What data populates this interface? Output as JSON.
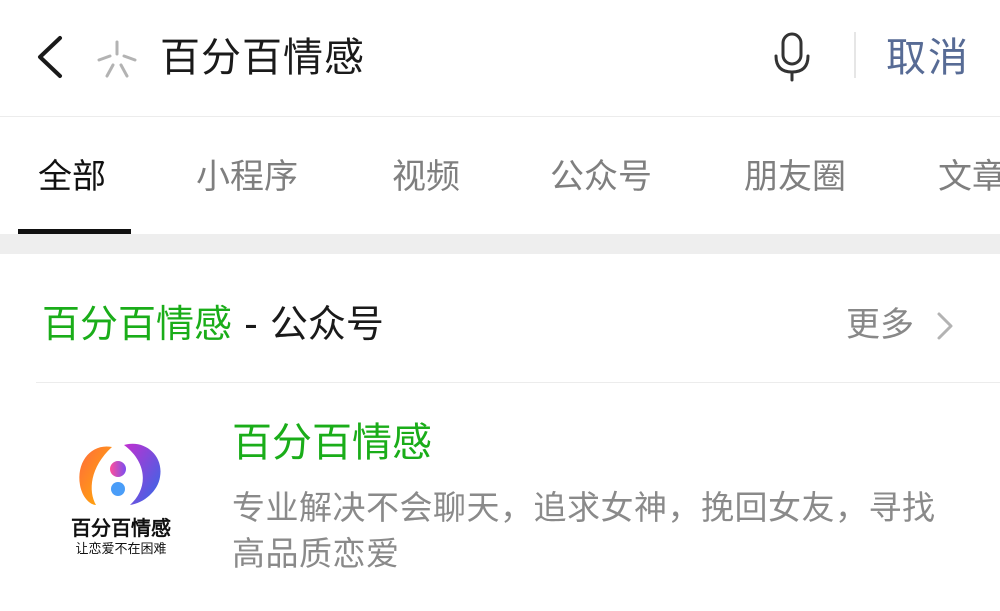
{
  "search": {
    "query": "百分百情感",
    "cancel_label": "取消"
  },
  "tabs": [
    {
      "label": "全部",
      "active": true
    },
    {
      "label": "小程序",
      "active": false
    },
    {
      "label": "视频",
      "active": false
    },
    {
      "label": "公众号",
      "active": false
    },
    {
      "label": "朋友圈",
      "active": false
    },
    {
      "label": "文章",
      "active": false
    }
  ],
  "section": {
    "highlight": "百分百情感",
    "rest": " - 公众号",
    "more_label": "更多"
  },
  "result": {
    "name": "百分百情感",
    "description": "专业解决不会聊天，追求女神，挽回女友，寻找高品质恋爱",
    "logo_text": "百分百情感",
    "logo_slogan": "让恋爱不在困难"
  },
  "colors": {
    "accent_green": "#1aad19",
    "link_blue": "#576b95",
    "muted_gray": "#888888"
  },
  "icons": {
    "back": "chevron-left-icon",
    "search": "wechat-search-icon",
    "voice": "microphone-icon",
    "more": "chevron-right-icon"
  }
}
